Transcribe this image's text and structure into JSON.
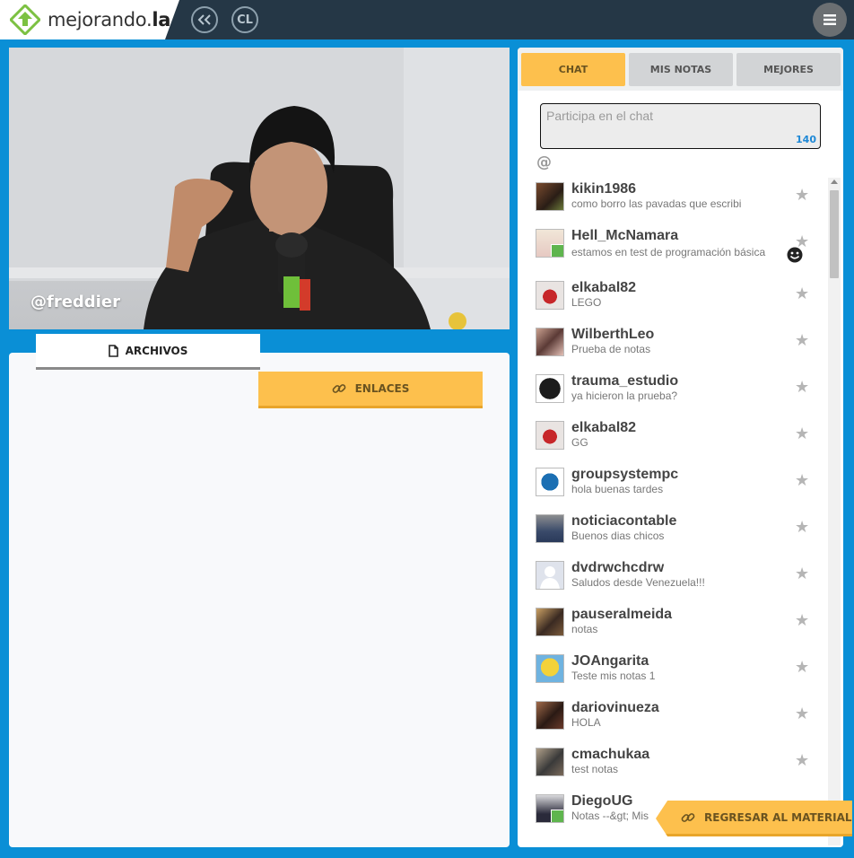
{
  "header": {
    "logo_text": "mejorando.",
    "logo_text_bold": "la",
    "back_icon": "double-chevron-left-icon",
    "cl_label": "CL",
    "menu_icon": "hamburger-menu-icon"
  },
  "video": {
    "handle": "@freddier"
  },
  "materials": {
    "tab_archivos": "ARCHIVOS",
    "tab_enlaces": "ENLACES"
  },
  "chat": {
    "tabs": [
      "CHAT",
      "MIS NOTAS",
      "MEJORES"
    ],
    "input_placeholder": "Participa en el chat",
    "char_count": "140",
    "mention_symbol": "@",
    "messages": [
      {
        "user": "kikin1986",
        "text": "como borro las pavadas que escribi"
      },
      {
        "user": "Hell_McNamara",
        "text": "estamos en test de programación básica"
      },
      {
        "user": "elkabal82",
        "text": "LEGO"
      },
      {
        "user": "WilberthLeo",
        "text": "Prueba de notas"
      },
      {
        "user": "trauma_estudio",
        "text": "ya hicieron la prueba?"
      },
      {
        "user": "elkabal82",
        "text": "GG"
      },
      {
        "user": "groupsystempc",
        "text": "hola buenas tardes"
      },
      {
        "user": "noticiacontable",
        "text": "Buenos dias chicos"
      },
      {
        "user": "dvdrwchcdrw",
        "text": "Saludos desde Venezuela!!!"
      },
      {
        "user": "pauseralmeida",
        "text": "notas"
      },
      {
        "user": "JOAngarita",
        "text": "Teste mis notas 1"
      },
      {
        "user": "dariovinueza",
        "text": "HOLA"
      },
      {
        "user": "cmachukaa",
        "text": "test notas"
      },
      {
        "user": "DiegoUG",
        "text": "Notas --&gt; Mis"
      }
    ],
    "back_button": "REGRESAR AL MATERIAL"
  },
  "colors": {
    "background": "#0a8fd6",
    "topbar": "#253746",
    "accent_yellow": "#fdc04d",
    "count_blue": "#1e88d6"
  }
}
